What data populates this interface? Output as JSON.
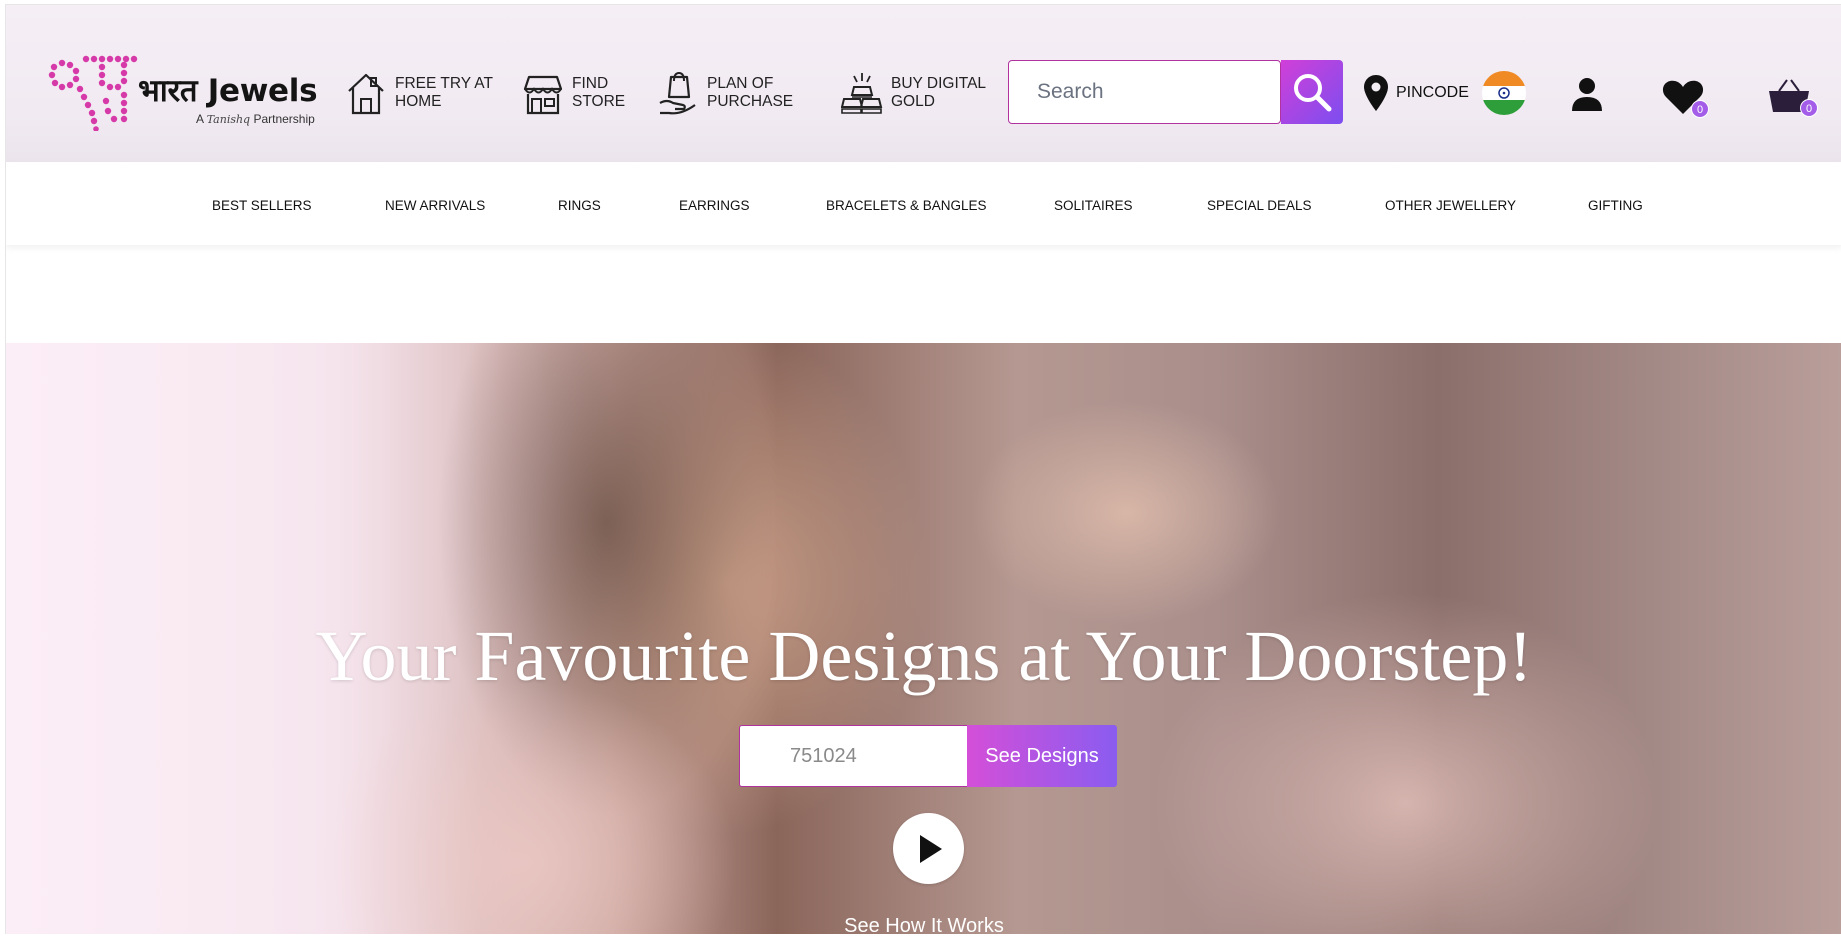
{
  "brand": {
    "name": "भारत Jewels",
    "tagline_prefix": "A",
    "tagline_partner": "Tanishq",
    "tagline_suffix": "Partnership",
    "color": "#d63aa8"
  },
  "header": {
    "features": [
      {
        "label": "FREE TRY AT\nHOME",
        "icon": "home-icon"
      },
      {
        "label": "FIND\nSTORE",
        "icon": "store-icon"
      },
      {
        "label": "PLAN OF\nPURCHASE",
        "icon": "shopping-bag-hand-icon"
      },
      {
        "label": "BUY DIGITAL\nGOLD",
        "icon": "gold-bars-icon"
      }
    ],
    "search_placeholder": "Search",
    "pincode_label": "PINCODE",
    "wishlist_count": "0",
    "cart_count": "0",
    "accent_gradient": [
      "#d13fd8",
      "#7c4ef0"
    ]
  },
  "nav": {
    "items": [
      "BEST SELLERS",
      "NEW ARRIVALS",
      "RINGS",
      "EARRINGS",
      "BRACELETS & BANGLES",
      "SOLITAIRES",
      "SPECIAL DEALS",
      "OTHER JEWELLERY",
      "GIFTING"
    ]
  },
  "hero": {
    "title": "Your Favourite Designs at Your Doorstep!",
    "pincode_placeholder": "751024",
    "cta_label": "See Designs",
    "how_label": "See How It Works"
  }
}
